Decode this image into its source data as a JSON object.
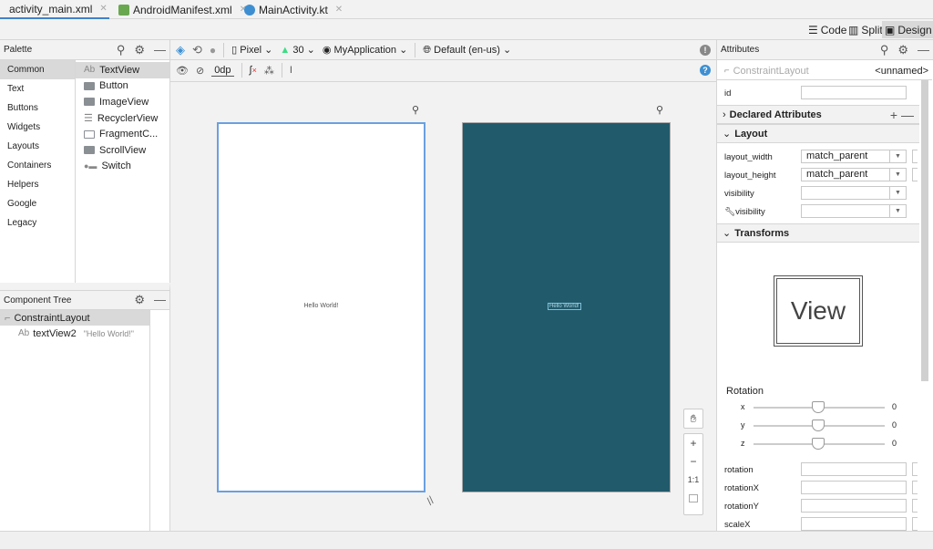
{
  "tabs": [
    {
      "label": "activity_main.xml",
      "active": true,
      "icon": "layout-xml-icon",
      "color": "#e07b39"
    },
    {
      "label": "AndroidManifest.xml",
      "active": false,
      "icon": "manifest-icon",
      "color": "#6aa84f"
    },
    {
      "label": "MainActivity.kt",
      "active": false,
      "icon": "kotlin-class-icon",
      "color": "#3d8fd1"
    }
  ],
  "modes": {
    "code": "Code",
    "split": "Split",
    "design": "Design",
    "selected": "Design"
  },
  "palette": {
    "title": "Palette",
    "categories": [
      "Common",
      "Text",
      "Buttons",
      "Widgets",
      "Layouts",
      "Containers",
      "Helpers",
      "Google",
      "Legacy"
    ],
    "selected_category": "Common",
    "items": [
      "TextView",
      "Button",
      "ImageView",
      "RecyclerView",
      "FragmentC...",
      "ScrollView",
      "Switch"
    ],
    "textview_prefix": "Ab"
  },
  "component_tree": {
    "title": "Component Tree",
    "root": "ConstraintLayout",
    "child_prefix": "Ab",
    "child": "textView2",
    "child_text": "\"Hello World!\""
  },
  "toolbar": {
    "device": "Pixel",
    "api": "30",
    "theme": "MyApplication",
    "locale": "Default (en-us)",
    "margin": "0dp"
  },
  "canvas": {
    "design_text": "Hello World!",
    "blueprint_text": "Hello World!",
    "blueprint_color": "#215a6b",
    "zoom": {
      "one_to_one": "1:1"
    }
  },
  "attributes": {
    "title": "Attributes",
    "component": "ConstraintLayout",
    "name": "<unnamed>",
    "id_label": "id",
    "id_value": "",
    "declared": "Declared Attributes",
    "layout_section": "Layout",
    "layout_width_label": "layout_width",
    "layout_width": "match_parent",
    "layout_height_label": "layout_height",
    "layout_height": "match_parent",
    "visibility_label": "visibility",
    "visibility": "",
    "tools_visibility_label": "visibility",
    "tools_visibility": "",
    "transforms": "Transforms",
    "preview": "View",
    "rotation_title": "Rotation",
    "rot": [
      {
        "axis": "x",
        "value": "0"
      },
      {
        "axis": "y",
        "value": "0"
      },
      {
        "axis": "z",
        "value": "0"
      }
    ],
    "fields": [
      "rotation",
      "rotationX",
      "rotationY",
      "scaleX"
    ]
  }
}
